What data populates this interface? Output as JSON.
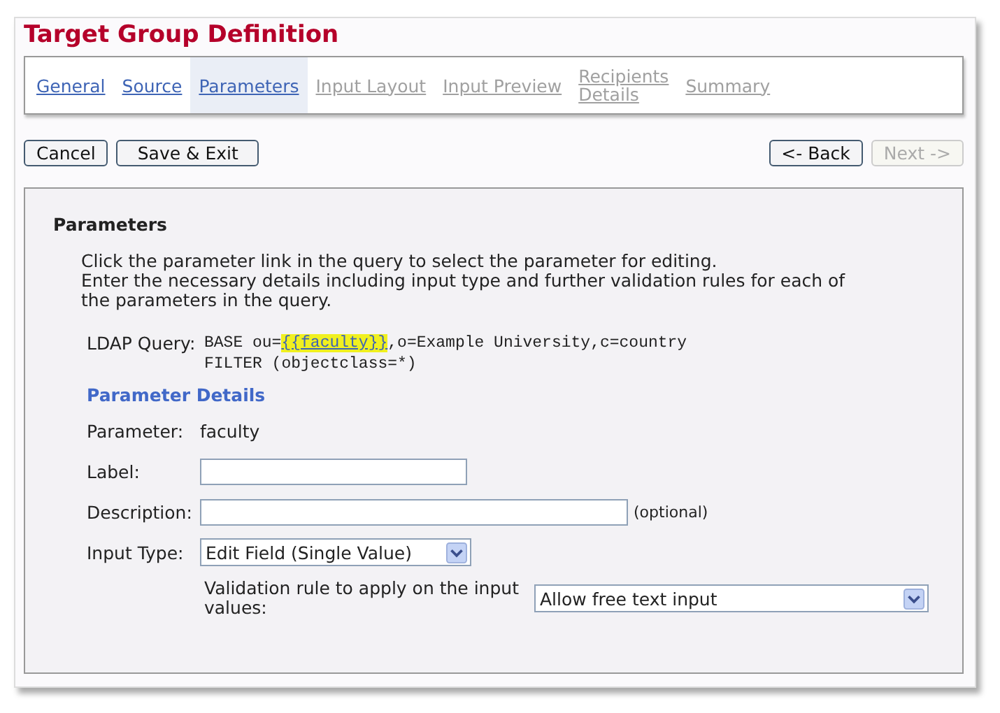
{
  "title": "Target Group Definition",
  "tabs": [
    {
      "label": "General",
      "selected": false,
      "disabled": false
    },
    {
      "label": "Source",
      "selected": false,
      "disabled": false
    },
    {
      "label": "Parameters",
      "selected": true,
      "disabled": false
    },
    {
      "label": "Input Layout",
      "selected": false,
      "disabled": true
    },
    {
      "label": "Input Preview",
      "selected": false,
      "disabled": true
    },
    {
      "label": "Recipients Details",
      "selected": false,
      "disabled": true
    },
    {
      "label": "Summary",
      "selected": false,
      "disabled": true
    }
  ],
  "left_buttons": [
    {
      "label": "Cancel",
      "disabled": false
    },
    {
      "label": "Save & Exit",
      "disabled": false
    }
  ],
  "right_buttons": [
    {
      "label": "<- Back",
      "disabled": false
    },
    {
      "label": "Next ->",
      "disabled": true
    }
  ],
  "panel": {
    "heading": "Parameters",
    "intro": [
      "Click the parameter link in the query to select the parameter for editing.",
      "Enter the necessary details including input type and further validation rules for each of the parameters in the query."
    ],
    "query_label": "LDAP Query:",
    "query_lines": [
      {
        "text": "BASE ou=",
        "param": "{{faculty}}",
        "rest": ",o=Example University,c=country"
      },
      {
        "text": "FILTER (objectclass=*)"
      }
    ],
    "details_heading": "Parameter Details",
    "fields": [
      {
        "kind": "text",
        "label": "Parameter:",
        "value": "faculty"
      },
      {
        "kind": "short_input",
        "label": "Label:"
      },
      {
        "kind": "long_input",
        "label": "Description:",
        "note": "(optional)"
      },
      {
        "kind": "select",
        "label": "Input Type:",
        "value": "Edit Field (Single Value)"
      }
    ],
    "validation": {
      "label": "Validation rule to apply on the input values:",
      "value": "Allow free text input"
    }
  }
}
